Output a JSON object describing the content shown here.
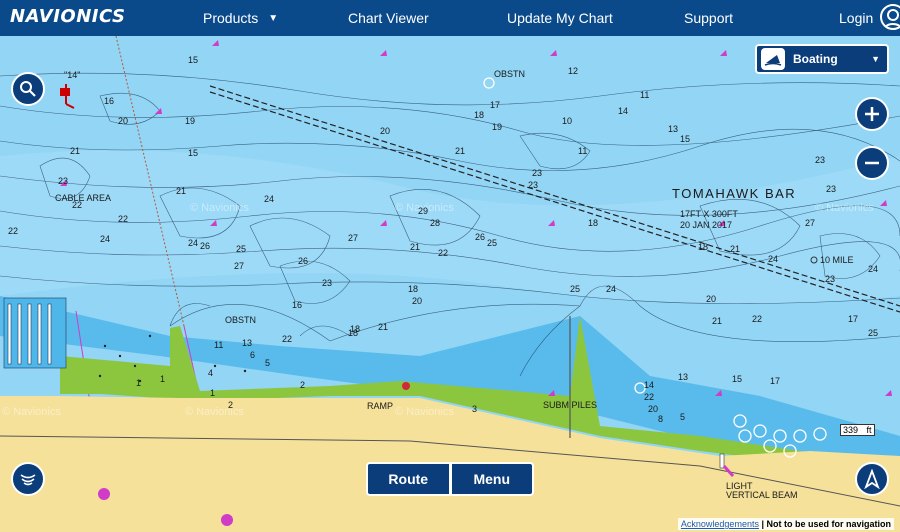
{
  "header": {
    "logo": "NAVIONICS",
    "nav": [
      {
        "label": "Products"
      },
      {
        "label": "Chart Viewer"
      },
      {
        "label": "Update My Chart"
      },
      {
        "label": "Support"
      }
    ],
    "login": "Login"
  },
  "mode_selector": {
    "label": "Boating"
  },
  "buttons": {
    "route": "Route",
    "menu": "Menu"
  },
  "map": {
    "labels": {
      "tomahawk": "TOMAHAWK BAR",
      "tomahawk_size": "17FT X 300FT",
      "tomahawk_date": "20 JAN 2017",
      "cable": "CABLE AREA",
      "obstn1": "OBSTN",
      "obstn2": "OBSTN",
      "ramp": "RAMP",
      "subm": "SUBM PILES",
      "mile": "10 MILE",
      "light1": "LIGHT",
      "light2": "VERTICAL BEAM",
      "quote14": "\"14\"",
      "watermark": "© Navionics"
    },
    "depths": [
      "15",
      "15",
      "16",
      "19",
      "20",
      "21",
      "23",
      "22",
      "22",
      "24",
      "17",
      "10",
      "14",
      "13",
      "15",
      "12",
      "11",
      "11",
      "18",
      "20",
      "21",
      "21",
      "22",
      "23",
      "23",
      "26",
      "25",
      "27",
      "24",
      "29",
      "28",
      "27",
      "26",
      "25",
      "22",
      "21",
      "24",
      "26",
      "23",
      "16",
      "18",
      "18",
      "20",
      "21",
      "11",
      "13",
      "22",
      "6",
      "5",
      "4",
      "18",
      "19",
      "18",
      "21",
      "22",
      "20",
      "21",
      "13",
      "15",
      "17",
      "17",
      "25",
      "24",
      "23",
      "24",
      "27",
      "23",
      "24",
      "25",
      "18",
      "23",
      "14",
      "22",
      "20",
      "8",
      "5",
      "3",
      "2",
      "1",
      "1",
      "1",
      "2"
    ]
  },
  "scale": {
    "value": "339",
    "unit": "ft"
  },
  "footer": {
    "ack": "Acknowledgements",
    "note": "| Not to be used for navigation"
  }
}
